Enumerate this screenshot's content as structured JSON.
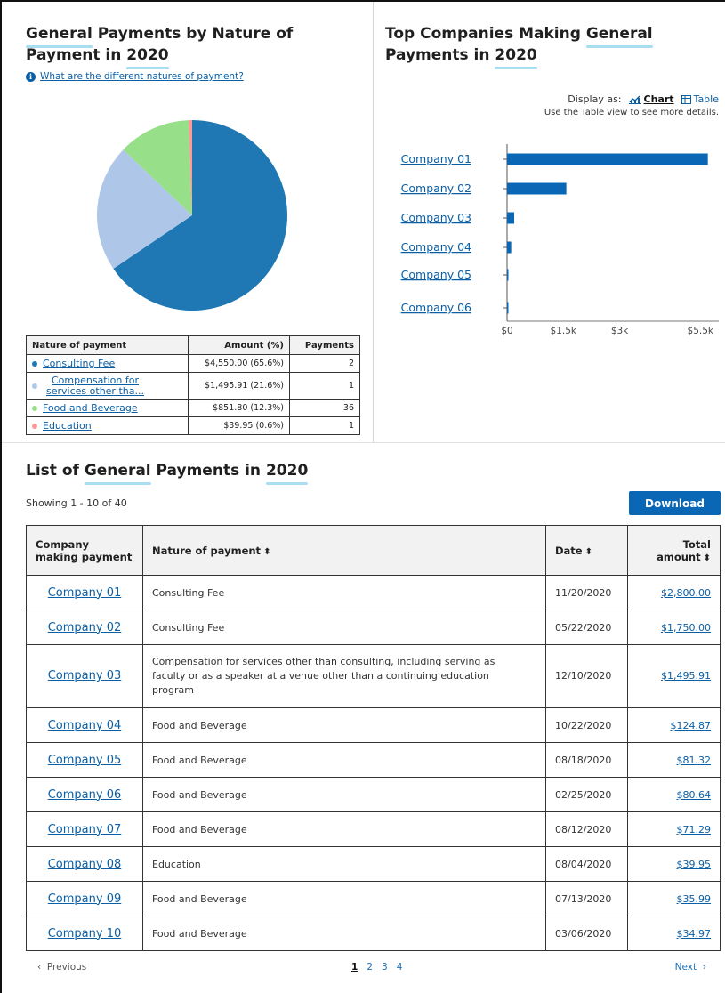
{
  "left_panel": {
    "title_part1": "General",
    "title_part2": " Payments by Nature of",
    "title_part3": "Payment in ",
    "title_year": "2020",
    "info_icon": "info-icon",
    "info_link": "What are the different natures of payment?"
  },
  "right_panel": {
    "title_part1": "Top Companies Making ",
    "title_part2": "General",
    "title_part3": "Payments in ",
    "title_year": "2020",
    "display_as_label": "Display as:",
    "chart_option": "Chart",
    "table_option": "Table",
    "hint": "Use the Table view to see more details."
  },
  "nature_table": {
    "headers": [
      "Nature of payment",
      "Amount (%)",
      "Payments"
    ],
    "rows": [
      {
        "nature": "Consulting Fee",
        "amount": "$4,550.00 (65.6%)",
        "payments": "2",
        "color": "#1f77b4"
      },
      {
        "nature": "Compensation for services other tha...",
        "amount": "$1,495.91 (21.6%)",
        "payments": "1",
        "color": "#aec7e8"
      },
      {
        "nature": "Food and Beverage",
        "amount": "$851.80 (12.3%)",
        "payments": "36",
        "color": "#98df8a"
      },
      {
        "nature": "Education",
        "amount": "$39.95 (0.6%)",
        "payments": "1",
        "color": "#ff9896"
      }
    ]
  },
  "chart_data": [
    {
      "type": "pie",
      "categories": [
        "Consulting Fee",
        "Compensation for services other tha...",
        "Food and Beverage",
        "Education"
      ],
      "values": [
        65.6,
        21.6,
        12.3,
        0.6
      ],
      "colors": [
        "#1f77b4",
        "#aec7e8",
        "#98df8a",
        "#ff9896"
      ]
    },
    {
      "type": "bar",
      "orientation": "horizontal",
      "categories": [
        "Company 01",
        "Company 02",
        "Company 03",
        "Company 04",
        "Company 05",
        "Company 06"
      ],
      "values": [
        5350,
        1580,
        190,
        110,
        10,
        5
      ],
      "xticks": [
        "$0",
        "$1.5k",
        "$3k",
        "$5.5k"
      ],
      "xtick_values": [
        0,
        1500,
        3000,
        5500
      ],
      "xlim": [
        0,
        5500
      ],
      "bar_color": "#0a67b5"
    }
  ],
  "list": {
    "title_part1": "List of ",
    "title_part2": "General",
    "title_part3": " Payments in ",
    "title_year": "2020",
    "showing": "Showing 1 - 10 of 40",
    "download": "Download",
    "headers": {
      "company": "Company making payment",
      "nature": "Nature of payment",
      "date": "Date",
      "amount": "Total amount",
      "sort_icon": "sort-icon"
    },
    "rows": [
      {
        "company": "Company 01",
        "nature": "Consulting Fee",
        "date": "11/20/2020",
        "amount": "$2,800.00"
      },
      {
        "company": "Company 02",
        "nature": "Consulting Fee",
        "date": "05/22/2020",
        "amount": "$1,750.00"
      },
      {
        "company": "Company 03",
        "nature": "Compensation for services other than consulting, including serving as faculty or as a speaker at a venue other than a continuing education program",
        "date": "12/10/2020",
        "amount": "$1,495.91"
      },
      {
        "company": "Company 04",
        "nature": "Food and Beverage",
        "date": "10/22/2020",
        "amount": "$124.87"
      },
      {
        "company": "Company 05",
        "nature": "Food and Beverage",
        "date": "08/18/2020",
        "amount": "$81.32"
      },
      {
        "company": "Company 06",
        "nature": "Food and Beverage",
        "date": "02/25/2020",
        "amount": "$80.64"
      },
      {
        "company": "Company 07",
        "nature": "Food and Beverage",
        "date": "08/12/2020",
        "amount": "$71.29"
      },
      {
        "company": "Company 08",
        "nature": "Education",
        "date": "08/04/2020",
        "amount": "$39.95"
      },
      {
        "company": "Company 09",
        "nature": "Food and Beverage",
        "date": "07/13/2020",
        "amount": "$35.99"
      },
      {
        "company": "Company 10",
        "nature": "Food and Beverage",
        "date": "03/06/2020",
        "amount": "$34.97"
      }
    ]
  },
  "pagination": {
    "previous": "Previous",
    "next": "Next",
    "pages": [
      "1",
      "2",
      "3",
      "4"
    ],
    "current": "1"
  }
}
